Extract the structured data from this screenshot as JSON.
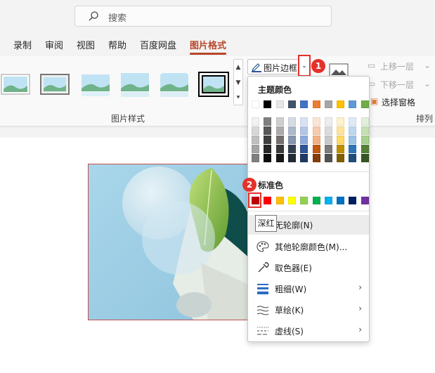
{
  "search": {
    "placeholder": "搜索"
  },
  "tabs": [
    {
      "label": "录制"
    },
    {
      "label": "审阅"
    },
    {
      "label": "视图"
    },
    {
      "label": "帮助"
    },
    {
      "label": "百度网盘"
    },
    {
      "label": "图片格式"
    }
  ],
  "ribbon": {
    "picture_styles_group": "图片样式",
    "picture_border_label": "图片边框",
    "bring_forward": "上移一层",
    "send_backward": "下移一层",
    "selection_pane": "选择窗格",
    "arrange_group": "排列"
  },
  "callouts": {
    "one": "1",
    "two": "2"
  },
  "dropdown": {
    "theme_colors_title": "主题颜色",
    "standard_colors_title": "标准色",
    "tooltip": "深红",
    "items": [
      {
        "label": "无轮廓(N)"
      },
      {
        "label": "其他轮廓颜色(M)..."
      },
      {
        "label": "取色器(E)"
      },
      {
        "label": "粗细(W)"
      },
      {
        "label": "草绘(K)"
      },
      {
        "label": "虚线(S)"
      }
    ],
    "theme_top_row": [
      "#ffffff",
      "#000000",
      "#e7e6e6",
      "#44546a",
      "#4472c4",
      "#ed7d31",
      "#a5a5a5",
      "#ffc000",
      "#5b9bd5",
      "#70ad47"
    ],
    "theme_shades": [
      [
        "#f2f2f2",
        "#7f7f7f",
        "#d0cece",
        "#d6dce4",
        "#d9e2f3",
        "#fbe5d5",
        "#ededed",
        "#fff2cc",
        "#deebf6",
        "#e2efd9"
      ],
      [
        "#d8d8d8",
        "#595959",
        "#aeabab",
        "#adb9ca",
        "#b4c6e7",
        "#f7cbac",
        "#dbdbdb",
        "#fee599",
        "#bdd7ee",
        "#c5e0b3"
      ],
      [
        "#bfbfbf",
        "#3f3f3f",
        "#757070",
        "#8496b0",
        "#8eaadb",
        "#f4b183",
        "#c9c9c9",
        "#ffd965",
        "#9dc3e6",
        "#a8d08d"
      ],
      [
        "#a5a5a5",
        "#262626",
        "#3a3838",
        "#323f4f",
        "#2f5496",
        "#c45911",
        "#7b7b7b",
        "#bf8f00",
        "#2e75b5",
        "#538135"
      ],
      [
        "#7f7f7f",
        "#0c0c0c",
        "#171616",
        "#222a35",
        "#1f3864",
        "#833c0b",
        "#525252",
        "#7f6000",
        "#1e4e79",
        "#375623"
      ]
    ],
    "standard_colors": [
      "#c00000",
      "#ff0000",
      "#ffc000",
      "#ffff00",
      "#92d050",
      "#00b050",
      "#00b0f0",
      "#0070c0",
      "#002060",
      "#7030a0"
    ]
  },
  "colors": {
    "accent": "#b7472a",
    "callout": "#e4312b"
  }
}
